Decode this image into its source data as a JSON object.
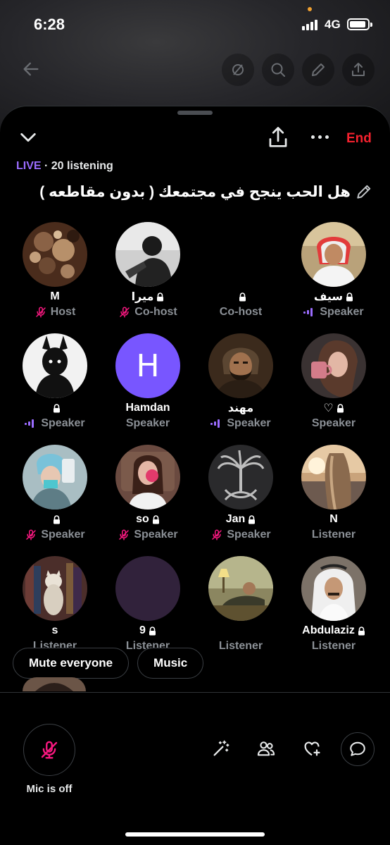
{
  "status_bar": {
    "time": "6:28",
    "network": "4G"
  },
  "header": {
    "end_label": "End"
  },
  "live": {
    "tag": "LIVE",
    "listening": " · 20 listening"
  },
  "space": {
    "title": "هل الحب ينجح في مجتمعك ( بدون مقاطعه )"
  },
  "participants": [
    {
      "name": "M",
      "role": "Host",
      "lock": false,
      "mic": "off",
      "avatar": "coffee"
    },
    {
      "name": "ميرا",
      "role": "Co-host",
      "lock": true,
      "mic": "off",
      "avatar": "bw-person"
    },
    {
      "name": "",
      "role": "Co-host",
      "lock": true,
      "mic": "none",
      "avatar": "none"
    },
    {
      "name": "سيف",
      "role": "Speaker",
      "lock": true,
      "mic": "speaking",
      "avatar": "man-white"
    },
    {
      "name": "",
      "role": "Speaker",
      "lock": true,
      "mic": "speaking",
      "avatar": "shadow-figure"
    },
    {
      "name": "Hamdan",
      "role": "Speaker",
      "lock": false,
      "mic": "none",
      "avatar": "letter-H",
      "initial": "H"
    },
    {
      "name": "مهند",
      "role": "Speaker",
      "lock": false,
      "mic": "speaking",
      "avatar": "painting-man"
    },
    {
      "name": "♡",
      "role": "Speaker",
      "lock": true,
      "mic": "none",
      "avatar": "woman-mug"
    },
    {
      "name": "",
      "role": "Speaker",
      "lock": true,
      "mic": "off",
      "avatar": "mirror-selfie"
    },
    {
      "name": "so",
      "role": "Speaker",
      "lock": true,
      "mic": "off",
      "avatar": "rose-girl"
    },
    {
      "name": "Jan",
      "role": "Speaker",
      "lock": true,
      "mic": "off",
      "avatar": "palm-emblem"
    },
    {
      "name": "N",
      "role": "Listener",
      "lock": false,
      "mic": "none",
      "avatar": "sunset-hair"
    },
    {
      "name": "s",
      "role": "Listener",
      "lock": false,
      "mic": "none",
      "avatar": "cat-books"
    },
    {
      "name": "9",
      "role": "Listener",
      "lock": true,
      "mic": "none",
      "avatar": "plain-purple"
    },
    {
      "name": "",
      "role": "Listener",
      "lock": false,
      "mic": "none",
      "avatar": "man-lamp"
    },
    {
      "name": "Abdulaziz",
      "role": "Listener",
      "lock": true,
      "mic": "none",
      "avatar": "man-ghutra"
    }
  ],
  "chips": {
    "mute_everyone": "Mute everyone",
    "music": "Music"
  },
  "footer": {
    "mic_label": "Mic is off"
  },
  "colors": {
    "accent_purple": "#9b6cff",
    "end_red": "#f4212e",
    "mic_off_pink": "#f91880",
    "muted_text": "#8b9096"
  }
}
